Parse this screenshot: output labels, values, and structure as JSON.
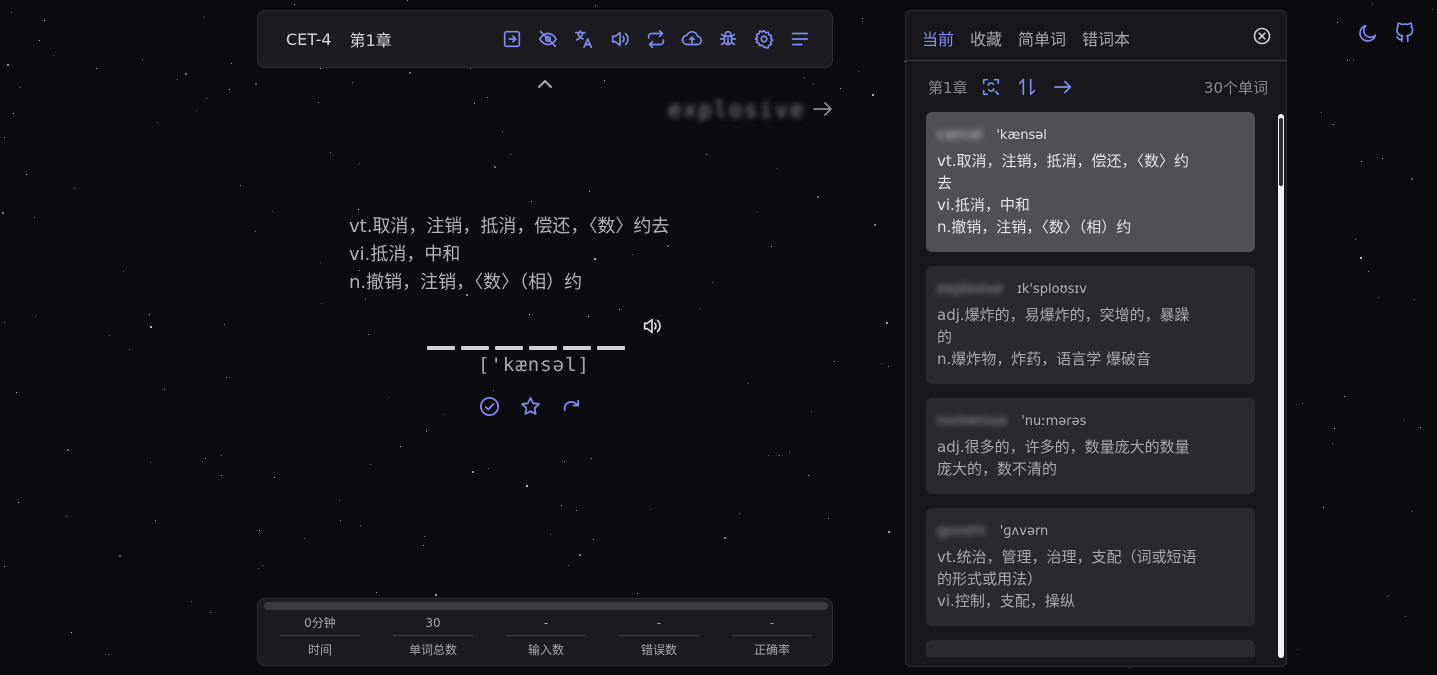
{
  "toolbar": {
    "dictionary": "CET-4",
    "chapter": "第1章",
    "icons": [
      "login-icon",
      "eye-off-icon",
      "translate-icon",
      "volume-icon",
      "repeat-icon",
      "cloud-upload-icon",
      "bug-icon",
      "gear-icon",
      "menu-icon"
    ]
  },
  "next_word": "explosive",
  "current_word": {
    "translation_lines": [
      "vt.取消，注销，抵消，偿还，〈数〉约去",
      "vi.抵消，中和",
      "n.撤销，注销，〈数〉（相）约"
    ],
    "letter_count": 6,
    "phonetic": "['kænsəl]"
  },
  "stats": {
    "progress": 0,
    "items": [
      {
        "value": "0分钟",
        "label": "时间"
      },
      {
        "value": "30",
        "label": "单词总数"
      },
      {
        "value": "-",
        "label": "输入数"
      },
      {
        "value": "-",
        "label": "错误数"
      },
      {
        "value": "-",
        "label": "正确率"
      }
    ]
  },
  "panel": {
    "tabs": [
      "当前",
      "收藏",
      "简单词",
      "错词本"
    ],
    "active_tab": 0,
    "chapter": "第1章",
    "word_count": "30个单词",
    "words": [
      {
        "word": "cancel",
        "phonetic": "'kænsəl",
        "translation_lines": [
          "vt.取消，注销，抵消，偿还，〈数〉约去",
          "vi.抵消，中和",
          "n.撤销，注销，〈数〉（相）约"
        ],
        "active": true
      },
      {
        "word": "explosive",
        "phonetic": "ɪk'sploʊsɪv",
        "translation_lines": [
          "adj.爆炸的，易爆炸的，突增的，暴躁的",
          "n.爆炸物，炸药，语言学 爆破音"
        ],
        "active": false
      },
      {
        "word": "numerous",
        "phonetic": "'nuːmərəs",
        "translation_lines": [
          "adj.很多的，许多的，数量庞大的数量庞大的，数不清的"
        ],
        "active": false
      },
      {
        "word": "govern",
        "phonetic": "'ɡʌvərn",
        "translation_lines": [
          "vt.统治，管理，治理，支配（词或短语的形式或用法）",
          "vi.控制，支配，操纵"
        ],
        "active": false
      }
    ]
  },
  "corner_icons": [
    "moon-icon",
    "github-icon"
  ],
  "colors": {
    "accent": "#7f8cf3",
    "background": "#0c0c10",
    "panel": "#18181c",
    "active_card": "#505054"
  }
}
